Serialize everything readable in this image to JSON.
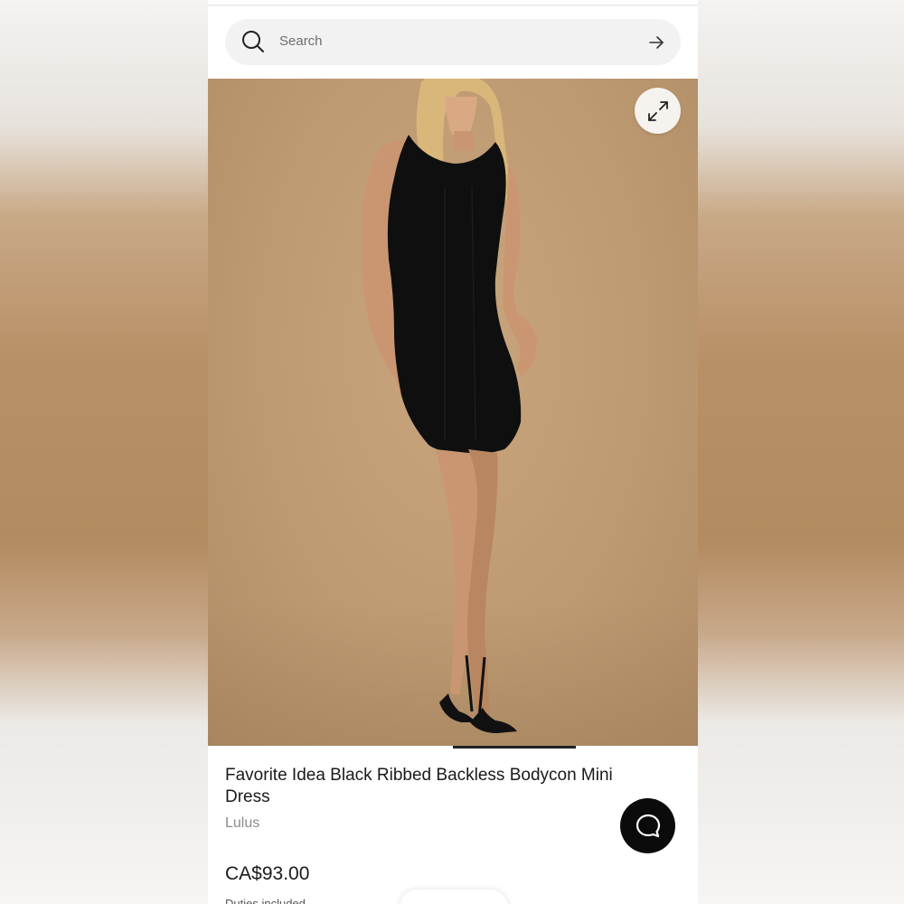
{
  "search": {
    "placeholder": "Search",
    "icon": "search-icon",
    "submit_icon": "arrow-right-icon"
  },
  "gallery": {
    "expand_icon": "expand-icon",
    "image_alt": "Model wearing black ribbed bodycon mini dress"
  },
  "product": {
    "title": "Favorite Idea Black Ribbed Backless Bodycon Mini Dress",
    "brand": "Lulus",
    "price": "CA$93.00",
    "duties_note": "Duties included"
  },
  "chat": {
    "icon": "chat-bubble-icon"
  },
  "colors": {
    "backdrop": "#bd9a72",
    "dress": "#0f0f0f",
    "accent": "#0b0b0b"
  }
}
